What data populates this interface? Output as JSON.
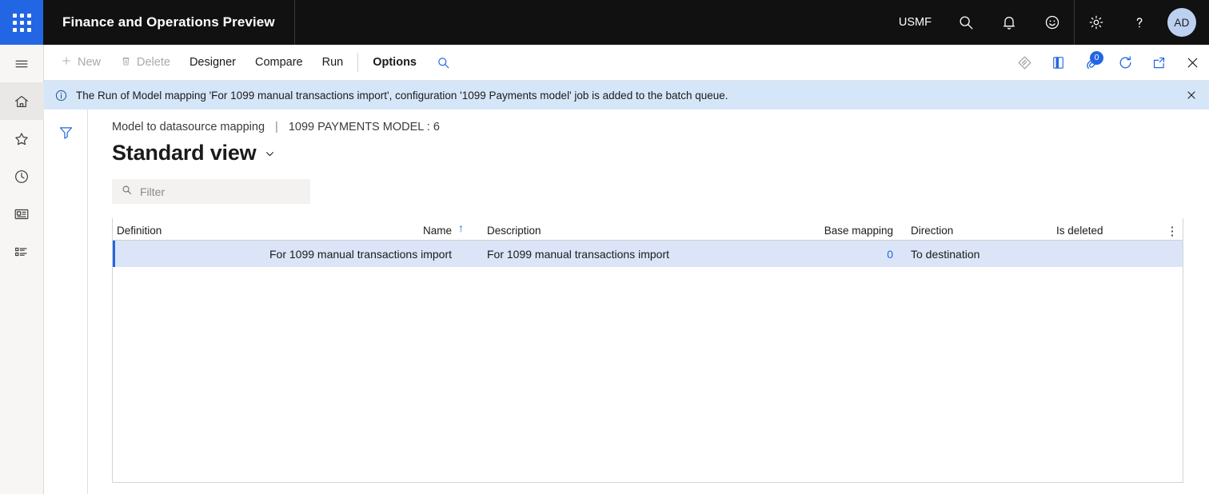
{
  "header": {
    "waffle_icon": "app-launcher-icon",
    "title": "Finance and Operations Preview",
    "company": "USMF",
    "icons": [
      {
        "name": "search-icon",
        "label": "Search"
      },
      {
        "name": "notifications-bell-icon",
        "label": "Notifications"
      },
      {
        "name": "feedback-smiley-icon",
        "label": "Feedback"
      },
      {
        "name": "settings-gear-icon",
        "label": "Settings"
      },
      {
        "name": "help-question-icon",
        "label": "Help"
      }
    ],
    "avatar_initials": "AD"
  },
  "rail": {
    "items": [
      {
        "name": "hamburger-menu-icon",
        "label": "Expand the navigation pane"
      },
      {
        "name": "home-icon",
        "label": "Home"
      },
      {
        "name": "favorites-star-icon",
        "label": "Favorites"
      },
      {
        "name": "recent-clock-icon",
        "label": "Recent"
      },
      {
        "name": "workspaces-icon",
        "label": "Workspaces"
      },
      {
        "name": "modules-list-icon",
        "label": "Modules"
      }
    ]
  },
  "toolbar": {
    "new_label": "New",
    "delete_label": "Delete",
    "designer_label": "Designer",
    "compare_label": "Compare",
    "run_label": "Run",
    "options_label": "Options",
    "search_icon": "search-icon",
    "right_icons": [
      {
        "name": "personalize-diamond-icon",
        "label": "Personalize"
      },
      {
        "name": "open-panel-icon",
        "label": "Open in new window"
      },
      {
        "name": "attachments-paperclip-icon",
        "label": "Attachments"
      },
      {
        "name": "refresh-icon",
        "label": "Refresh"
      },
      {
        "name": "pop-out-icon",
        "label": "Open in new tab"
      },
      {
        "name": "close-icon",
        "label": "Close"
      }
    ],
    "attachment_count": "0"
  },
  "message": {
    "info_icon": "info-circle-icon",
    "text": "The Run of Model mapping 'For 1099 manual transactions import', configuration '1099 Payments model' job is added to the batch queue.",
    "close_icon": "close-icon"
  },
  "filter_pane": {
    "funnel_icon": "filter-funnel-icon"
  },
  "page": {
    "breadcrumb_parent": "Model to datasource mapping",
    "breadcrumb_separator": "|",
    "breadcrumb_current": "1099 PAYMENTS MODEL : 6",
    "title": "Standard view",
    "title_chevron": "chevron-down-icon"
  },
  "filter": {
    "icon": "search-icon",
    "placeholder": "Filter",
    "value": ""
  },
  "grid": {
    "columns": [
      {
        "key": "definition",
        "label": "Definition",
        "align": "left"
      },
      {
        "key": "name",
        "label": "Name",
        "align": "right",
        "sorted": "asc"
      },
      {
        "key": "description",
        "label": "Description",
        "align": "left"
      },
      {
        "key": "base_mapping",
        "label": "Base mapping",
        "align": "right"
      },
      {
        "key": "direction",
        "label": "Direction",
        "align": "left"
      },
      {
        "key": "is_deleted",
        "label": "Is deleted",
        "align": "left"
      }
    ],
    "sort_arrow": "↑",
    "more_icon": "overflow-menu-icon",
    "rows": [
      {
        "definition": "",
        "name": "For 1099 manual transactions import",
        "description": "For 1099 manual transactions import",
        "base_mapping": "0",
        "direction": "To destination",
        "is_deleted": "",
        "selected": true
      }
    ]
  },
  "colors": {
    "accent": "#2266e3",
    "header_bg": "#111111",
    "message_bg": "#d6e6f9",
    "row_selected_bg": "#dbe5f7",
    "rail_bg": "#f7f6f5"
  }
}
